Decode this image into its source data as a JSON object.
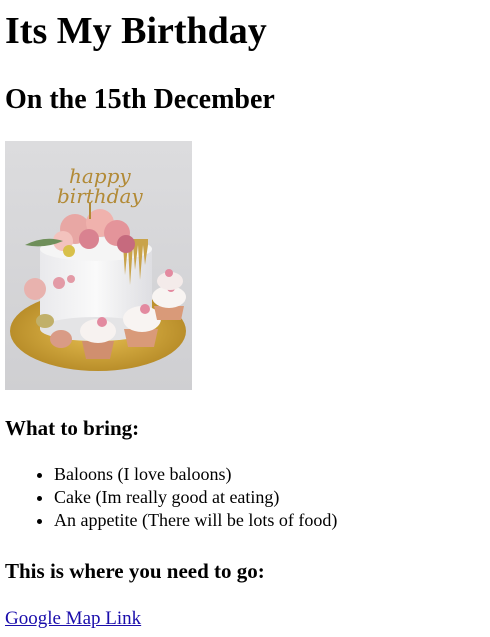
{
  "page": {
    "title": "Its My Birthday",
    "subtitle": "On the 15th December",
    "image": {
      "topper_text": [
        "happy",
        "birthday"
      ]
    },
    "bring": {
      "heading": "What to bring:",
      "items": [
        {
          "label": "Baloons (I love baloons)"
        },
        {
          "label": "Cake (Im really good at eating)"
        },
        {
          "label": "An appetite (There will be lots of food)"
        }
      ]
    },
    "where": {
      "heading": "This is where you need to go:",
      "link_text": "Google Map Link"
    }
  },
  "colors": {
    "link": "#1a0dab",
    "text": "#000000",
    "background": "#ffffff"
  }
}
